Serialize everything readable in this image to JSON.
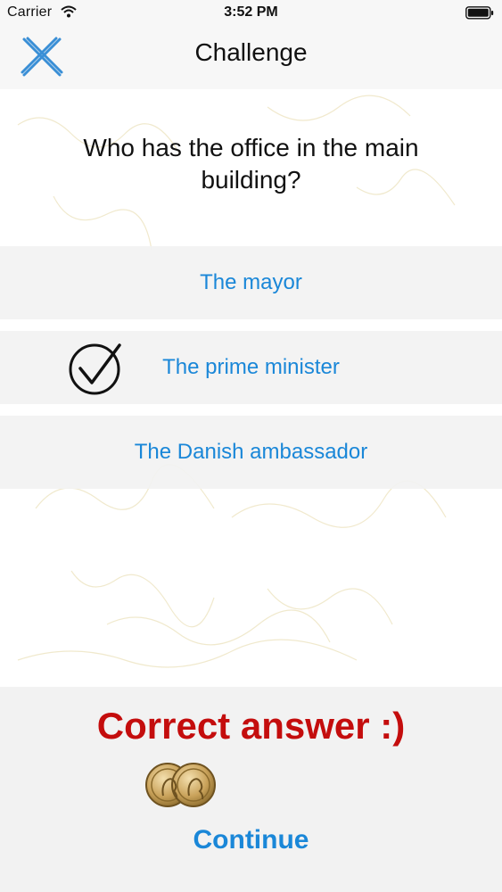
{
  "status_bar": {
    "carrier": "Carrier",
    "time": "3:52 PM",
    "wifi_icon": "wifi-icon",
    "battery_icon": "battery-icon"
  },
  "nav": {
    "title": "Challenge",
    "close_icon": "close-icon"
  },
  "question": "Who has the office in the main building?",
  "answers": [
    {
      "label": "The mayor",
      "selected": false
    },
    {
      "label": "The prime minister",
      "selected": true
    },
    {
      "label": "The Danish ambassador",
      "selected": false
    }
  ],
  "result": {
    "message": "Correct answer :)",
    "reward_icon": "coins-icon",
    "continue_label": "Continue"
  },
  "colors": {
    "accent": "#1a87d8",
    "result_red": "#c40d0d",
    "panel_gray": "#f2f2f2",
    "coin_gold": "#c9a25a"
  }
}
